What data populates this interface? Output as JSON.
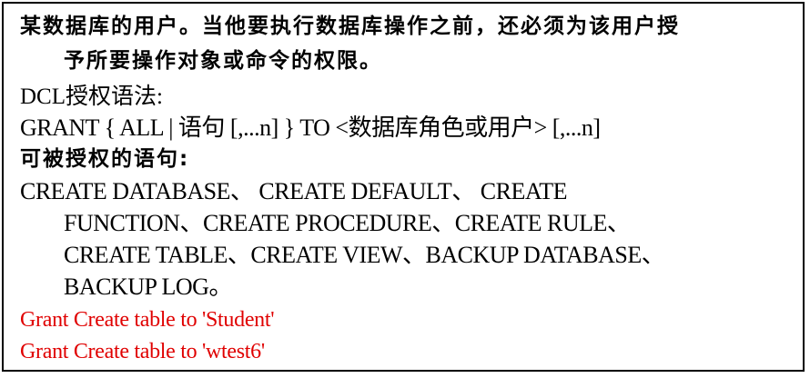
{
  "document": {
    "lines": [
      "某数据库的用户。当他要执行数据库操作之前，还必须为该用户授",
      "予所要操作对象或命令的权限。",
      "DCL授权语法:",
      "GRANT { ALL | 语句 [,...n] } TO <数据库角色或用户> [,...n]",
      "可被授权的语句:",
      "CREATE DATABASE、 CREATE DEFAULT、 CREATE",
      "FUNCTION、CREATE PROCEDURE、CREATE RULE、",
      "CREATE TABLE、CREATE VIEW、BACKUP DATABASE、",
      "BACKUP LOG。"
    ],
    "examples": [
      "Grant Create table to 'Student'",
      "Grant Create table to 'wtest6'"
    ]
  },
  "colors": {
    "text": "#000000",
    "example": "#e00000",
    "border": "#000000"
  }
}
